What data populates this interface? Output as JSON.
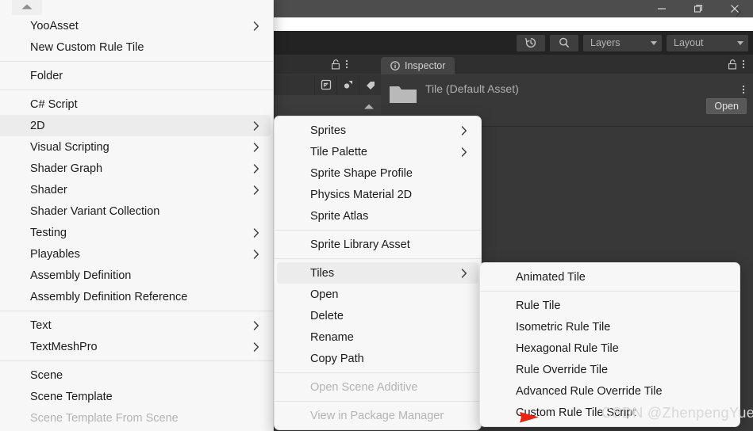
{
  "window": {
    "controls": [
      {
        "name": "minimize",
        "glyph": "minimize-icon"
      },
      {
        "name": "restore",
        "glyph": "restore-icon"
      },
      {
        "name": "close",
        "glyph": "close-icon"
      }
    ]
  },
  "toolbar": {
    "history_icon": "history-icon",
    "search_icon": "search-icon",
    "layers_label": "Layers",
    "layout_label": "Layout"
  },
  "inspector": {
    "tab_label": "Inspector",
    "info_icon": "info-icon",
    "lock_icon": "lock-icon",
    "kebab_icon": "kebab-menu-icon",
    "asset_title": "Tile (Default Asset)",
    "folder_icon": "folder-icon",
    "open_label": "Open"
  },
  "menu1": {
    "scroll_up": "scroll-up-arrow-icon",
    "items": [
      {
        "label": "YooAsset",
        "submenu": true
      },
      {
        "label": "New Custom Rule Tile"
      },
      {
        "sep": true
      },
      {
        "label": "Folder"
      },
      {
        "sep": true
      },
      {
        "label": "C# Script"
      },
      {
        "label": "2D",
        "submenu": true,
        "selected": true
      },
      {
        "label": "Visual Scripting",
        "submenu": true
      },
      {
        "label": "Shader Graph",
        "submenu": true
      },
      {
        "label": "Shader",
        "submenu": true
      },
      {
        "label": "Shader Variant Collection"
      },
      {
        "label": "Testing",
        "submenu": true
      },
      {
        "label": "Playables",
        "submenu": true
      },
      {
        "label": "Assembly Definition"
      },
      {
        "label": "Assembly Definition Reference"
      },
      {
        "sep": true
      },
      {
        "label": "Text",
        "submenu": true
      },
      {
        "label": "TextMeshPro",
        "submenu": true
      },
      {
        "sep": true
      },
      {
        "label": "Scene"
      },
      {
        "label": "Scene Template"
      },
      {
        "label": "Scene Template From Scene",
        "disabled": true
      }
    ]
  },
  "menu2": {
    "items": [
      {
        "label": "Sprites",
        "submenu": true
      },
      {
        "label": "Tile Palette",
        "submenu": true
      },
      {
        "label": "Sprite Shape Profile"
      },
      {
        "label": "Physics Material 2D"
      },
      {
        "label": "Sprite Atlas"
      },
      {
        "sep": true
      },
      {
        "label": "Sprite Library Asset"
      },
      {
        "sep": true
      },
      {
        "label": "Tiles",
        "submenu": true,
        "selected": true
      },
      {
        "label": "Open"
      },
      {
        "label": "Delete"
      },
      {
        "label": "Rename"
      },
      {
        "label": "Copy Path"
      },
      {
        "sep": true
      },
      {
        "label": "Open Scene Additive",
        "disabled": true
      },
      {
        "sep": true
      },
      {
        "label": "View in Package Manager",
        "disabled": true
      }
    ]
  },
  "menu3": {
    "items": [
      {
        "label": "Animated Tile"
      },
      {
        "sep": true
      },
      {
        "label": "Rule Tile"
      },
      {
        "label": "Isometric Rule Tile"
      },
      {
        "label": "Hexagonal Rule Tile"
      },
      {
        "label": "Rule Override Tile"
      },
      {
        "label": "Advanced Rule Override Tile"
      },
      {
        "label": "Custom Rule Tile Script"
      }
    ]
  },
  "annotation": {
    "arrow": "red-arrow-annotation",
    "arrow_color": "#ee2211",
    "watermark": "CSDN @ZhenpengYue"
  },
  "colors": {
    "menu_bg": "#f7f7f7",
    "menu_highlight": "#ececec",
    "unity_bg": "#383838",
    "unity_toolbar": "#232323",
    "titlebar": "#4d4d4d"
  }
}
